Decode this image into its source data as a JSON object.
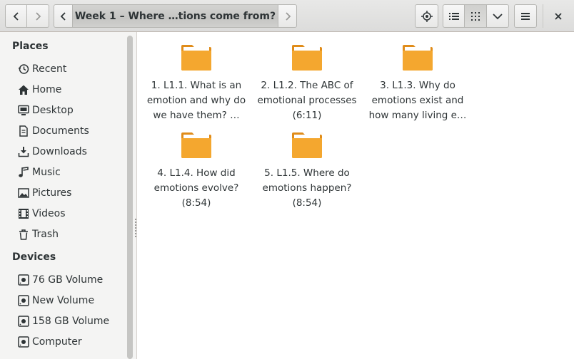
{
  "header": {
    "back_icon": "chevron-left-icon",
    "forward_icon": "chevron-right-icon",
    "path_left_icon": "chevron-left-icon",
    "path_right_icon": "chevron-right-icon",
    "current_folder": "Week 1 – Where …tions come from?",
    "location_icon": "location-target-icon",
    "list_view_icon": "list-view-icon",
    "grid_view_icon": "grid-view-icon",
    "view_options_icon": "chevron-down-icon",
    "menu_icon": "hamburger-menu-icon",
    "close_icon": "close-icon"
  },
  "sidebar": {
    "places_heading": "Places",
    "places": [
      {
        "label": "Recent",
        "icon": "recent-clock-icon"
      },
      {
        "label": "Home",
        "icon": "home-icon"
      },
      {
        "label": "Desktop",
        "icon": "desktop-icon"
      },
      {
        "label": "Documents",
        "icon": "document-icon"
      },
      {
        "label": "Downloads",
        "icon": "download-icon"
      },
      {
        "label": "Music",
        "icon": "music-icon"
      },
      {
        "label": "Pictures",
        "icon": "pictures-icon"
      },
      {
        "label": "Videos",
        "icon": "videos-icon"
      },
      {
        "label": "Trash",
        "icon": "trash-icon"
      }
    ],
    "devices_heading": "Devices",
    "devices": [
      {
        "label": "76 GB Volume",
        "icon": "drive-icon"
      },
      {
        "label": "New Volume",
        "icon": "drive-icon"
      },
      {
        "label": "158 GB Volume",
        "icon": "drive-icon"
      },
      {
        "label": "Computer",
        "icon": "drive-icon"
      }
    ]
  },
  "files": [
    {
      "name": "1. L1.1. What is an emotion and why do we have them? …",
      "icon": "folder-icon"
    },
    {
      "name": "2. L1.2. The ABC of emotional processes (6:11)",
      "icon": "folder-icon"
    },
    {
      "name": "3. L1.3. Why do emotions exist and how many living e…",
      "icon": "folder-icon"
    },
    {
      "name": "4. L1.4. How did emotions evolve? (8:54)",
      "icon": "folder-icon"
    },
    {
      "name": "5. L1.5. Where do emotions happen? (8:54)",
      "icon": "folder-icon"
    }
  ],
  "colors": {
    "folder": "#f4a72f",
    "folder_dark": "#e08c1a",
    "accent": "#2e3436"
  }
}
